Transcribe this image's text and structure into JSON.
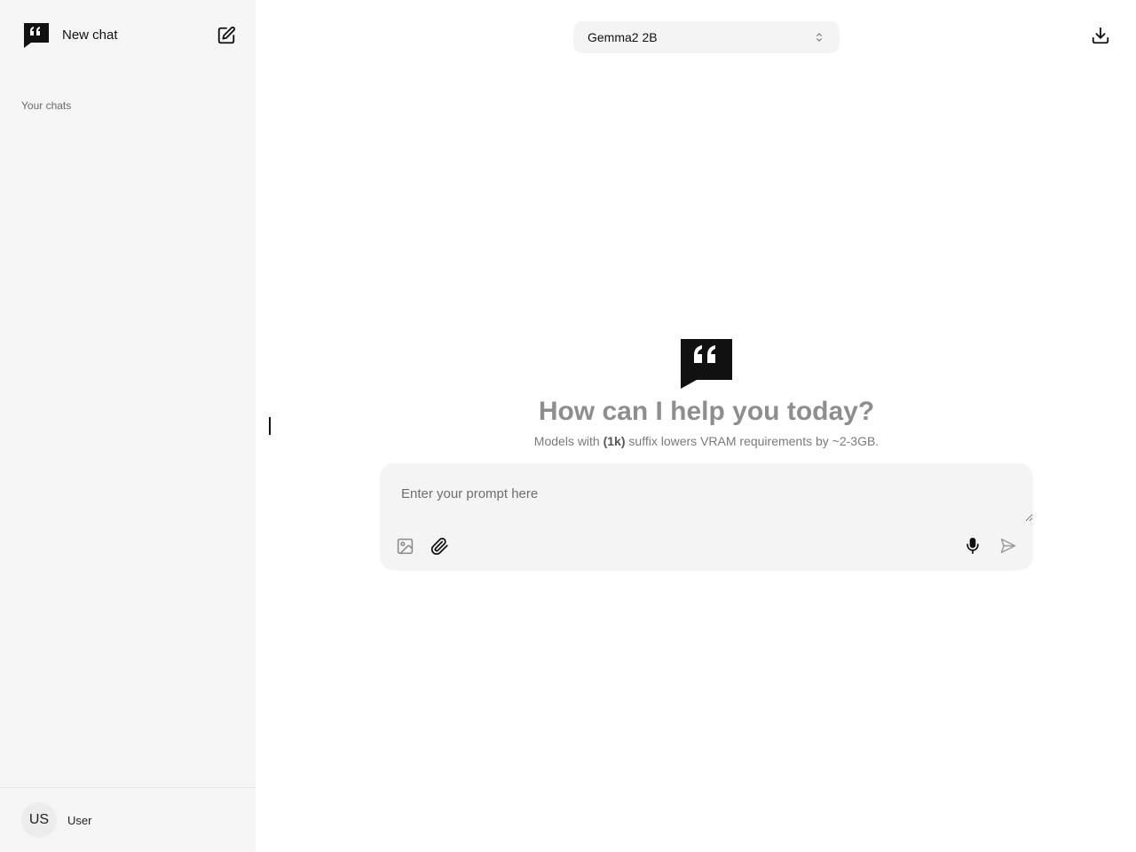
{
  "sidebar": {
    "new_chat_label": "New chat",
    "section_label": "Your chats",
    "user": {
      "initials": "US",
      "name": "User"
    }
  },
  "header": {
    "model_selected": "Gemma2 2B"
  },
  "main": {
    "greeting": "How can I help you today?",
    "subtitle_prefix": "Models with ",
    "subtitle_bold": "(1k)",
    "subtitle_suffix": " suffix lowers VRAM requirements by ~2-3GB."
  },
  "composer": {
    "placeholder": "Enter your prompt here",
    "value": ""
  },
  "icons": {
    "logo": "quote-chat-icon",
    "new_chat": "edit-icon",
    "model_select": "chevron-updown-icon",
    "download": "download-icon",
    "image": "image-icon",
    "attach": "paperclip-icon",
    "mic": "microphone-icon",
    "send": "send-icon"
  },
  "colors": {
    "sidebar_bg": "#f5f5f5",
    "composer_bg": "#f4f4f4",
    "greeting_text": "#8e8e8e"
  }
}
